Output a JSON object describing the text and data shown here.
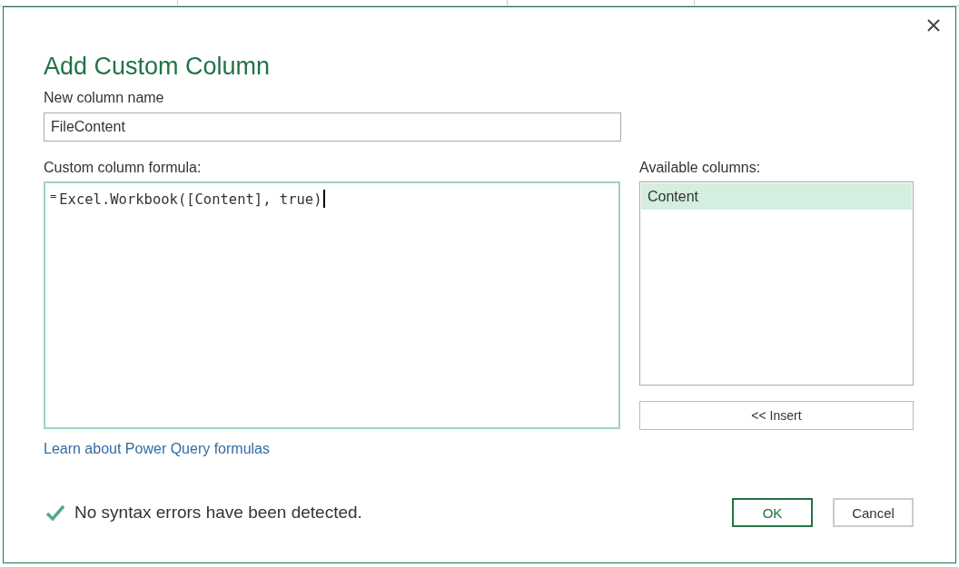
{
  "dialog": {
    "title": "Add Custom Column",
    "column_name": {
      "label": "New column name",
      "value": "FileContent"
    },
    "formula": {
      "label": "Custom column formula:",
      "prefix": "=",
      "value": "Excel.Workbook([Content], true)"
    },
    "available_columns": {
      "label": "Available columns:",
      "items": [
        {
          "label": "Content",
          "selected": true
        }
      ]
    },
    "insert_button": "<< Insert",
    "help_link": "Learn about Power Query formulas",
    "status": {
      "ok": true,
      "message": "No syntax errors have been detected."
    },
    "buttons": [
      {
        "label": "OK",
        "kind": "primary"
      },
      {
        "label": "Cancel",
        "kind": "secondary"
      }
    ]
  }
}
